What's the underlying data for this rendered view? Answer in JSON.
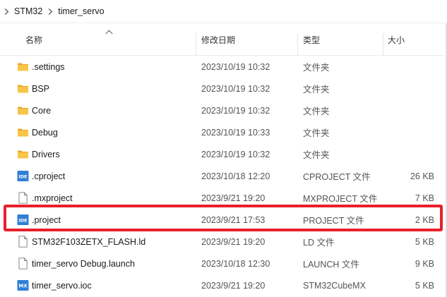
{
  "breadcrumb": {
    "items": [
      {
        "label": "STM32"
      },
      {
        "label": "timer_servo"
      }
    ]
  },
  "columns": {
    "name": "名称",
    "date": "修改日期",
    "type": "类型",
    "size": "大小"
  },
  "files": [
    {
      "name": ".settings",
      "date": "2023/10/19 10:32",
      "type": "文件夹",
      "size": "",
      "icon": "folder-icon"
    },
    {
      "name": "BSP",
      "date": "2023/10/19 10:32",
      "type": "文件夹",
      "size": "",
      "icon": "folder-icon"
    },
    {
      "name": "Core",
      "date": "2023/10/19 10:32",
      "type": "文件夹",
      "size": "",
      "icon": "folder-icon"
    },
    {
      "name": "Debug",
      "date": "2023/10/19 10:33",
      "type": "文件夹",
      "size": "",
      "icon": "folder-icon"
    },
    {
      "name": "Drivers",
      "date": "2023/10/19 10:32",
      "type": "文件夹",
      "size": "",
      "icon": "folder-icon"
    },
    {
      "name": ".cproject",
      "date": "2023/10/18 12:20",
      "type": "CPROJECT 文件",
      "size": "26 KB",
      "icon": "ide-file-icon",
      "icon_text": "IDE"
    },
    {
      "name": ".mxproject",
      "date": "2023/9/21 19:20",
      "type": "MXPROJECT 文件",
      "size": "7 KB",
      "icon": "blank-file-icon"
    },
    {
      "name": ".project",
      "date": "2023/9/21 17:53",
      "type": "PROJECT 文件",
      "size": "2 KB",
      "icon": "ide-file-icon",
      "icon_text": "IDE"
    },
    {
      "name": "STM32F103ZETX_FLASH.ld",
      "date": "2023/9/21 19:20",
      "type": "LD 文件",
      "size": "5 KB",
      "icon": "blank-file-icon"
    },
    {
      "name": "timer_servo Debug.launch",
      "date": "2023/10/18 12:30",
      "type": "LAUNCH 文件",
      "size": "9 KB",
      "icon": "blank-file-icon"
    },
    {
      "name": "timer_servo.ioc",
      "date": "2023/9/21 19:20",
      "type": "STM32CubeMX",
      "size": "5 KB",
      "icon": "mx-file-icon",
      "icon_text": "MX"
    }
  ],
  "colors": {
    "folder": "#f7c548",
    "folder_dark": "#e9a825",
    "ide_badge": "#2f7fd6",
    "highlight": "#e8202a"
  }
}
